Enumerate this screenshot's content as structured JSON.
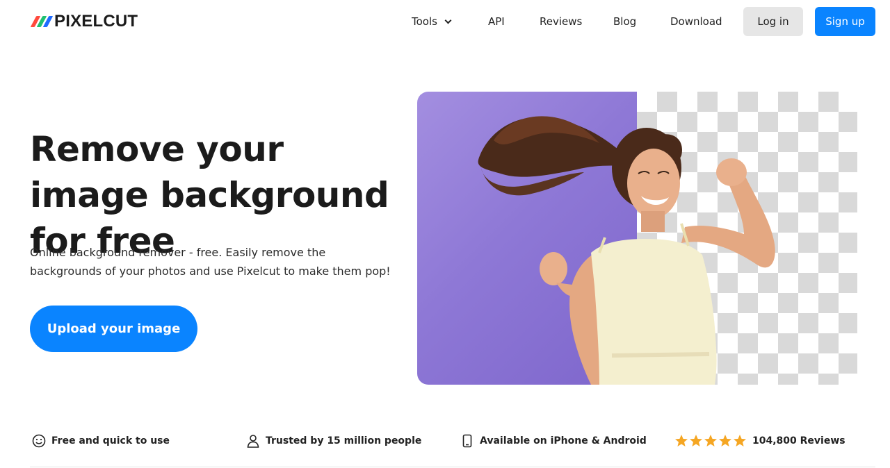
{
  "nav": {
    "logo_text": "PIXELCUT",
    "logo_colors": [
      "#ff4a3d",
      "#20c070",
      "#1e6bff"
    ],
    "links": [
      "Tools",
      "API",
      "Reviews",
      "Blog",
      "Download"
    ],
    "login_label": "Log in",
    "signup_label": "Sign up"
  },
  "hero": {
    "title": "Remove your image background for free",
    "subtitle_line1": "Online background remover - free. Easily remove the",
    "subtitle_line2": "backgrounds of your photos and use Pixelcut to make them pop!",
    "upload_label": "Upload your image",
    "image_background_color": "#8e78d6"
  },
  "features": [
    {
      "icon": "smiley-icon",
      "label": "Free and quick to use"
    },
    {
      "icon": "person-icon",
      "label": "Trusted by 15 million people"
    },
    {
      "icon": "phone-icon",
      "label": "Available on iPhone & Android"
    },
    {
      "icon": "star-icon",
      "label": "104,800 Reviews",
      "stars": 5
    }
  ],
  "colors": {
    "accent": "#0a84ff",
    "star": "#f5a623"
  }
}
